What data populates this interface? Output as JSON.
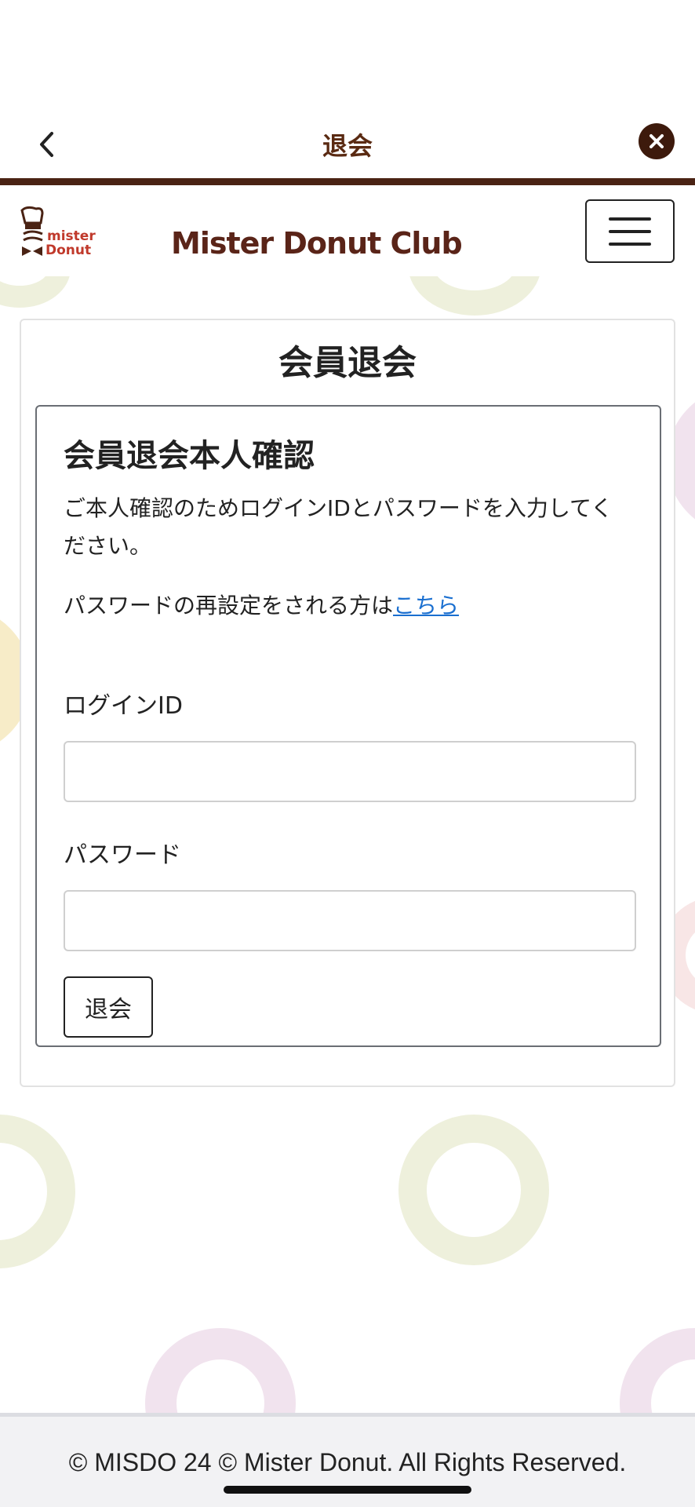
{
  "nav": {
    "title": "退会",
    "back_icon": "chevron-left-icon",
    "close_icon": "close-icon"
  },
  "header": {
    "logo_text_1": "mister",
    "logo_text_2": "Donut",
    "club_name": "Mister Donut Club"
  },
  "card": {
    "title": "会員退会"
  },
  "form": {
    "heading": "会員退会本人確認",
    "instruction": "ご本人確認のためログインIDとパスワードを入力してください。",
    "reset_prefix": "パスワードの再設定をされる方は",
    "reset_link": "こちら",
    "login_label": "ログインID",
    "login_value": "",
    "password_label": "パスワード",
    "password_value": "",
    "submit_label": "退会"
  },
  "footer": {
    "copyright": "© MISDO 24 © Mister Donut. All Rights Reserved."
  },
  "colors": {
    "brand_brown": "#4a2314",
    "link_blue": "#1a6fd0"
  }
}
